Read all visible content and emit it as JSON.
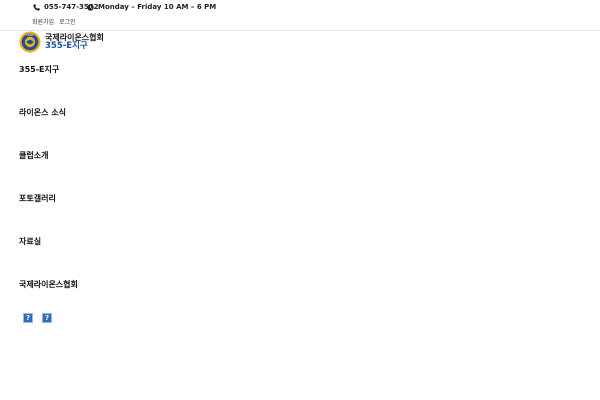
{
  "topbar": {
    "phone": "055-747-3552",
    "hours": "Monday – Friday 10 AM – 6 PM",
    "signup": "회원가입",
    "login": "로그인"
  },
  "logo": {
    "title": "국제라이온스협회",
    "subtitle": "355-E지구"
  },
  "menu": [
    "355-E지구",
    "라이온스 소식",
    "클럽소개",
    "포토갤러리",
    "자료실",
    "국제라이온스협회"
  ],
  "social_icons": [
    "facebook-icon",
    "blog-icon"
  ],
  "colors": {
    "accent": "#1e4fa3",
    "logo_gold": "#e8b11c",
    "logo_blue": "#1f4aa0"
  }
}
